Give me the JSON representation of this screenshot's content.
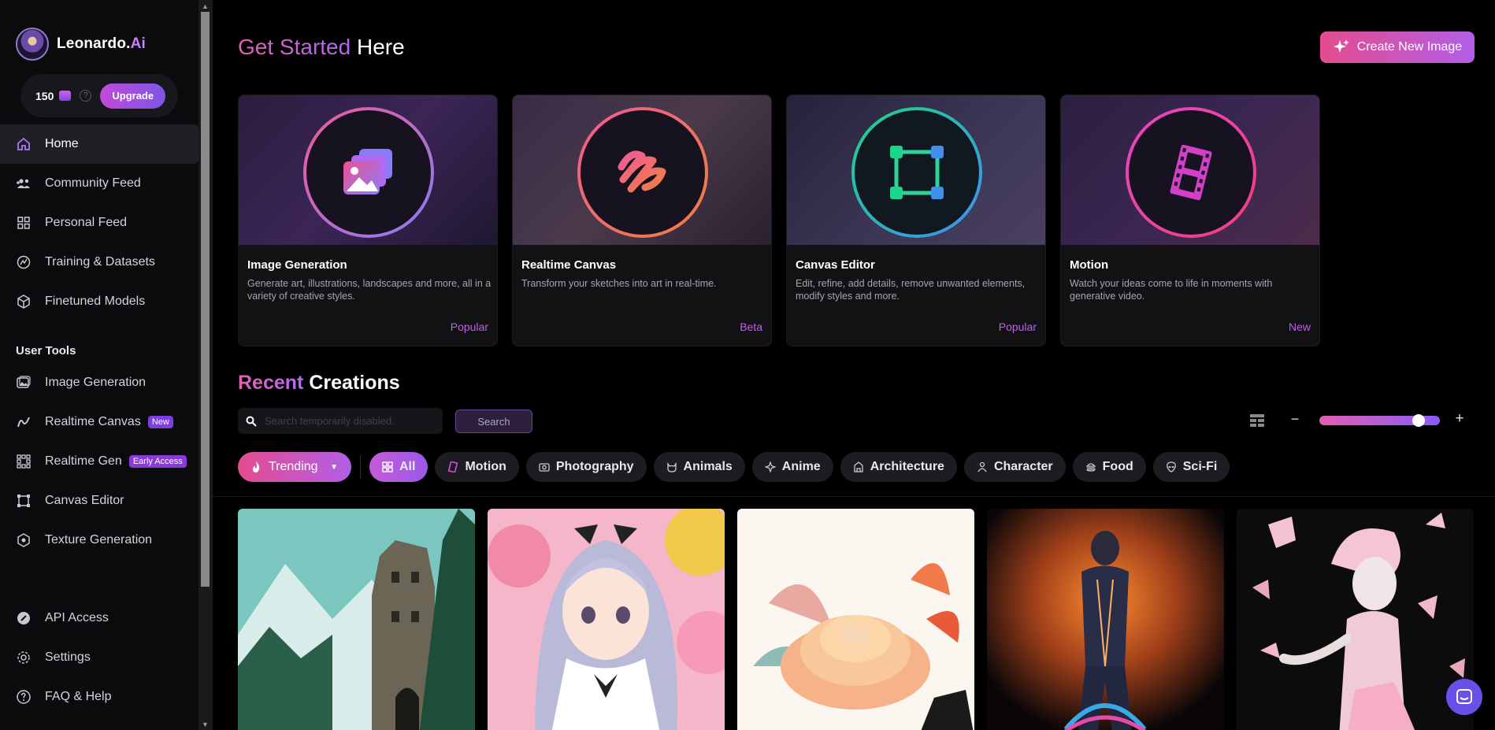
{
  "brand": {
    "name": "Leonardo.",
    "suffix": "Ai"
  },
  "credits": {
    "count": "150",
    "upgrade_label": "Upgrade"
  },
  "nav": {
    "main": [
      {
        "label": "Home",
        "icon": "home-icon",
        "active": true
      },
      {
        "label": "Community Feed",
        "icon": "users-icon"
      },
      {
        "label": "Personal Feed",
        "icon": "grid-icon"
      },
      {
        "label": "Training & Datasets",
        "icon": "training-icon"
      },
      {
        "label": "Finetuned Models",
        "icon": "cube-icon"
      }
    ],
    "section_title": "User Tools",
    "tools": [
      {
        "label": "Image Generation",
        "icon": "image-icon"
      },
      {
        "label": "Realtime Canvas",
        "icon": "brush-icon",
        "badge": "New"
      },
      {
        "label": "Realtime Gen",
        "icon": "dots-grid-icon",
        "badge": "Early Access"
      },
      {
        "label": "Canvas Editor",
        "icon": "canvas-icon"
      },
      {
        "label": "Texture Generation",
        "icon": "texture-icon"
      }
    ],
    "bottom": [
      {
        "label": "API Access",
        "icon": "api-icon"
      },
      {
        "label": "Settings",
        "icon": "gear-icon"
      },
      {
        "label": "FAQ & Help",
        "icon": "help-icon"
      }
    ]
  },
  "header": {
    "title_accent": "Get Started",
    "title_rest": "Here",
    "create_label": "Create New Image"
  },
  "cards": [
    {
      "title": "Image Generation",
      "desc": "Generate art, illustrations, landscapes and more, all in a variety of creative styles.",
      "tag": "Popular",
      "icon": "image-stack-icon"
    },
    {
      "title": "Realtime Canvas",
      "desc": "Transform your sketches into art in real-time.",
      "tag": "Beta",
      "icon": "scribble-icon"
    },
    {
      "title": "Canvas Editor",
      "desc": "Edit, refine, add details, remove unwanted elements, modify styles and more.",
      "tag": "Popular",
      "icon": "bounding-box-icon"
    },
    {
      "title": "Motion",
      "desc": "Watch your ideas come to life in moments with generative video.",
      "tag": "New",
      "icon": "film-icon"
    }
  ],
  "recent": {
    "title_accent": "Recent",
    "title_rest": "Creations",
    "search_placeholder": "Search temporarily disabled.",
    "search_label": "Search",
    "zoom_level": 0.86
  },
  "filters": {
    "sort": "Trending",
    "chips": [
      {
        "label": "All",
        "icon": "grid-icon",
        "active": true
      },
      {
        "label": "Motion",
        "icon": "film-icon"
      },
      {
        "label": "Photography",
        "icon": "camera-icon"
      },
      {
        "label": "Animals",
        "icon": "cat-icon"
      },
      {
        "label": "Anime",
        "icon": "sparkle-icon"
      },
      {
        "label": "Architecture",
        "icon": "building-icon"
      },
      {
        "label": "Character",
        "icon": "person-icon"
      },
      {
        "label": "Food",
        "icon": "burger-icon"
      },
      {
        "label": "Sci-Fi",
        "icon": "alien-icon"
      }
    ]
  },
  "colors": {
    "accent_pink": "#e35fb3",
    "accent_purple": "#9a59ea",
    "bg": "#000000",
    "sidebar_bg": "#0b0b0d"
  }
}
